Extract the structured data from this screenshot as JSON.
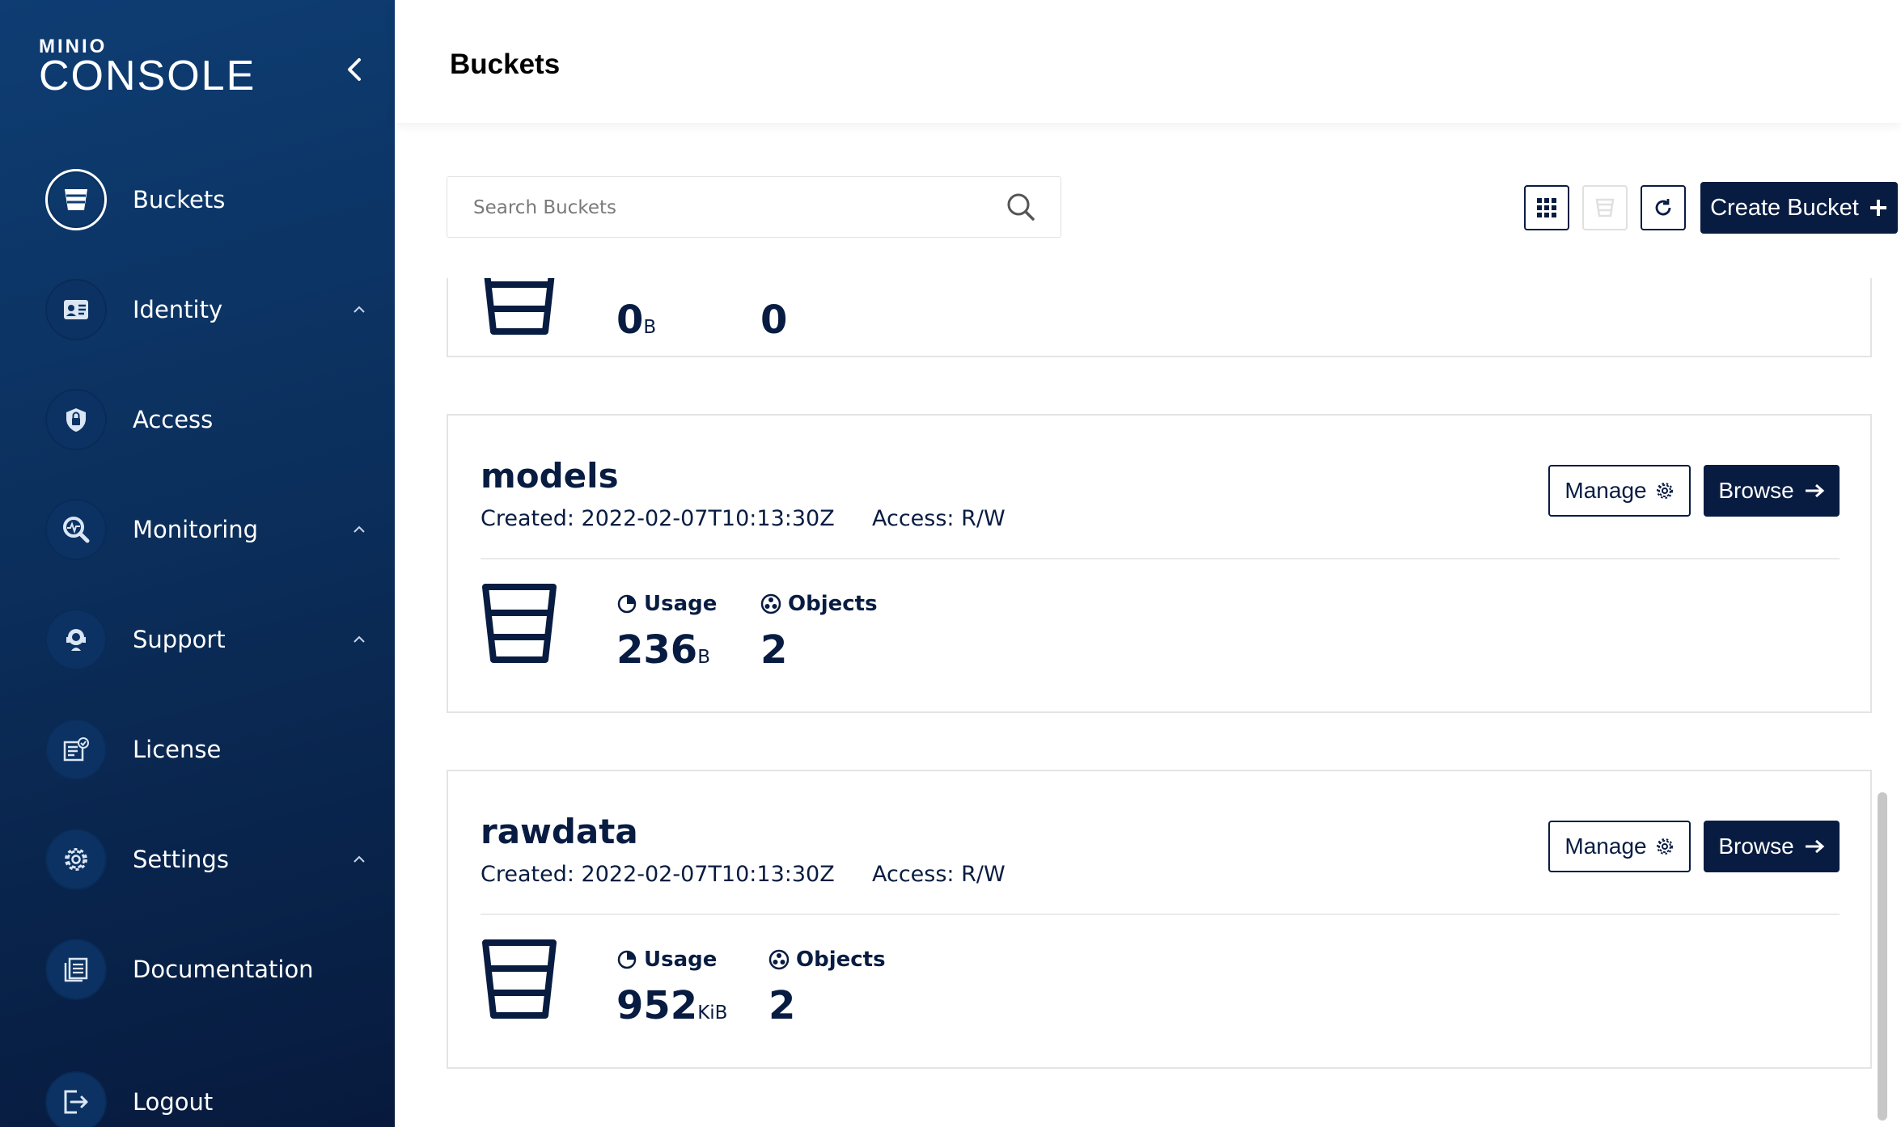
{
  "sidebar": {
    "logo_top": "MINIO",
    "logo_main": "CONSOLE",
    "items": [
      {
        "label": "Buckets",
        "icon": "bucket-icon",
        "active": true
      },
      {
        "label": "Identity",
        "icon": "id-card-icon",
        "expandable": true
      },
      {
        "label": "Access",
        "icon": "lock-icon"
      },
      {
        "label": "Monitoring",
        "icon": "monitoring-icon",
        "expandable": true
      },
      {
        "label": "Support",
        "icon": "support-icon",
        "expandable": true
      },
      {
        "label": "License",
        "icon": "license-icon"
      },
      {
        "label": "Settings",
        "icon": "gear-icon",
        "expandable": true
      },
      {
        "label": "Documentation",
        "icon": "documentation-icon"
      },
      {
        "label": "Logout",
        "icon": "logout-icon"
      }
    ]
  },
  "header": {
    "title": "Buckets"
  },
  "toolbar": {
    "search_placeholder": "Search Buckets",
    "create_label": "Create Bucket"
  },
  "buckets": [
    {
      "name": "",
      "created": "",
      "access": "",
      "usage_value": "0",
      "usage_unit": "B",
      "objects": "0"
    },
    {
      "name": "models",
      "created": "Created: 2022-02-07T10:13:30Z",
      "access": "Access: R/W",
      "usage_label": "Usage",
      "usage_value": "236",
      "usage_unit": "B",
      "objects_label": "Objects",
      "objects": "2",
      "manage_label": "Manage",
      "browse_label": "Browse"
    },
    {
      "name": "rawdata",
      "created": "Created: 2022-02-07T10:13:30Z",
      "access": "Access: R/W",
      "usage_label": "Usage",
      "usage_value": "952",
      "usage_unit": "KiB",
      "objects_label": "Objects",
      "objects": "2",
      "manage_label": "Manage",
      "browse_label": "Browse"
    }
  ],
  "colors": {
    "brand_dark": "#081c42",
    "sidebar_top": "#0e3d73",
    "sidebar_bottom": "#071a3d"
  }
}
